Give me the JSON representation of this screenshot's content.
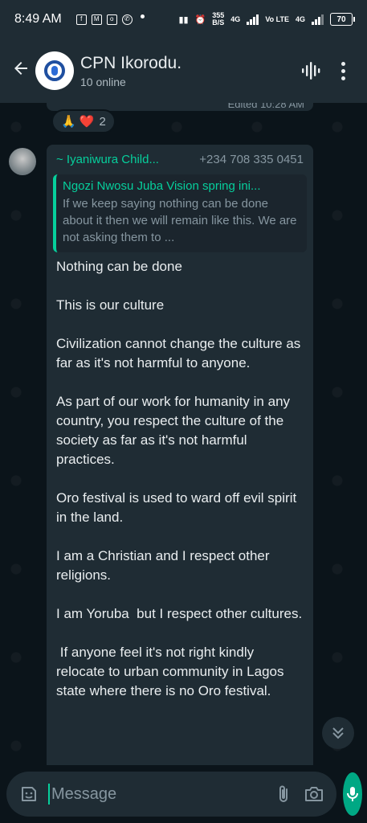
{
  "status_bar": {
    "time": "8:49 AM",
    "speed_value": "355",
    "speed_unit": "B/S",
    "network": "4G",
    "network2": "Vo LTE",
    "network3": "4G",
    "battery": "70"
  },
  "header": {
    "title": "CPN Ikorodu.",
    "subtitle": "10 online"
  },
  "previous_message": {
    "edited_label": "Edited 10:28 AM",
    "reaction_emojis": "🙏 ❤️",
    "reaction_count": "2"
  },
  "message": {
    "sender_name": "~ Iyaniwura Child...",
    "sender_phone": "+234 708 335 0451",
    "quote_author": "Ngozi Nwosu Juba Vision spring ini...",
    "quote_text": "If we keep saying nothing can be done about it then we will remain like this. We are not asking them to ...",
    "body": "Nothing can be done\n\nThis is our culture\n\nCivilization cannot change the culture as far as it's not harmful to anyone.\n\nAs part of our work for humanity in any country, you respect the culture of the society as far as it's not harmful practices.\n\nOro festival is used to ward off evil spirit in the land.\n\nI am a Christian and I respect other religions.\n\nI am Yoruba  but I respect other cultures.\n\n If anyone feel it's not right kindly relocate to urban community in Lagos state where there is no Oro festival."
  },
  "composer": {
    "placeholder": "Message"
  },
  "colors": {
    "accent": "#06cf9c",
    "bubble": "#1f2c34",
    "background": "#0b141a",
    "mic_button": "#00a884"
  }
}
